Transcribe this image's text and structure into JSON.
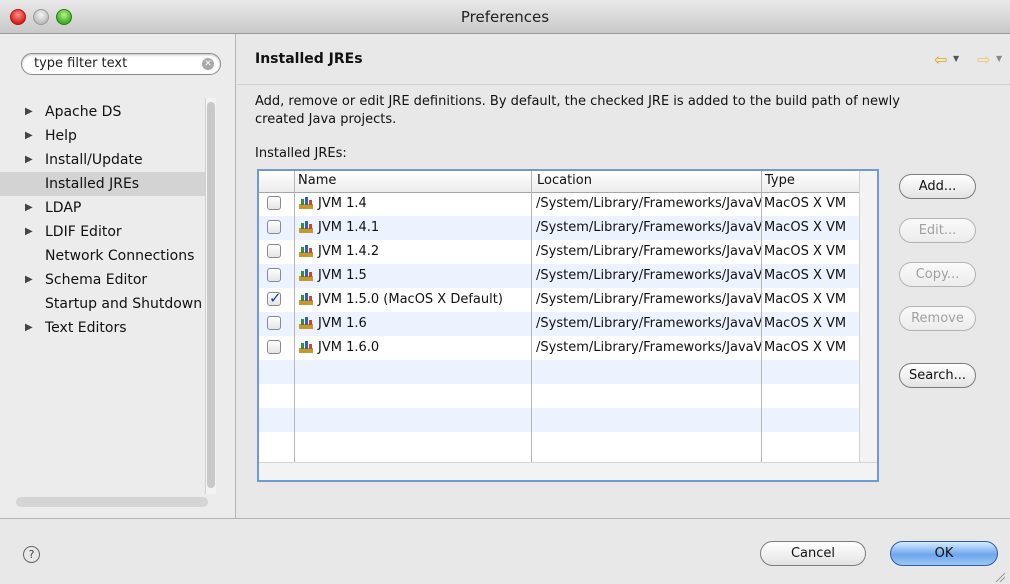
{
  "window": {
    "title": "Preferences"
  },
  "filter": {
    "placeholder": "type filter text"
  },
  "tree": [
    {
      "label": "Apache DS",
      "expandable": true
    },
    {
      "label": "Help",
      "expandable": true
    },
    {
      "label": "Install/Update",
      "expandable": true
    },
    {
      "label": "Installed JREs",
      "expandable": false,
      "selected": true
    },
    {
      "label": "LDAP",
      "expandable": true
    },
    {
      "label": "LDIF Editor",
      "expandable": true
    },
    {
      "label": "Network Connections",
      "expandable": false
    },
    {
      "label": "Schema Editor",
      "expandable": true
    },
    {
      "label": "Startup and Shutdown",
      "expandable": false
    },
    {
      "label": "Text Editors",
      "expandable": true
    }
  ],
  "page": {
    "title": "Installed JREs",
    "description_line1": "Add, remove or edit JRE definitions. By default, the checked JRE is added to the build path of newly",
    "description_line2": "created Java projects.",
    "table_label": "Installed JREs:"
  },
  "table": {
    "columns": [
      "Name",
      "Location",
      "Type"
    ],
    "rows": [
      {
        "name": "JVM 1.4",
        "location": "/System/Library/Frameworks/JavaVM.framework",
        "type": "MacOS X VM",
        "checked": false
      },
      {
        "name": "JVM 1.4.1",
        "location": "/System/Library/Frameworks/JavaVM.framework",
        "type": "MacOS X VM",
        "checked": false
      },
      {
        "name": "JVM 1.4.2",
        "location": "/System/Library/Frameworks/JavaVM.framework",
        "type": "MacOS X VM",
        "checked": false
      },
      {
        "name": "JVM 1.5",
        "location": "/System/Library/Frameworks/JavaVM.framework",
        "type": "MacOS X VM",
        "checked": false
      },
      {
        "name": "JVM 1.5.0 (MacOS X Default)",
        "location": "/System/Library/Frameworks/JavaVM.framework",
        "type": "MacOS X VM",
        "checked": true
      },
      {
        "name": "JVM 1.6",
        "location": "/System/Library/Frameworks/JavaVM.framework",
        "type": "MacOS X VM",
        "checked": false
      },
      {
        "name": "JVM 1.6.0",
        "location": "/System/Library/Frameworks/JavaVM.framework",
        "type": "MacOS X VM",
        "checked": false
      }
    ]
  },
  "buttons": {
    "add": "Add...",
    "edit": "Edit...",
    "copy": "Copy...",
    "remove": "Remove",
    "search": "Search..."
  },
  "footer": {
    "help": "?",
    "cancel": "Cancel",
    "ok": "OK"
  },
  "icons": {
    "nav_back": "back-arrow-icon",
    "nav_forward": "forward-arrow-icon",
    "jre": "jre-library-icon"
  },
  "colors": {
    "selection_border": "#6f9ad0",
    "ok_button": "#6ea6ec",
    "row_stripe": "#edf3fe"
  }
}
